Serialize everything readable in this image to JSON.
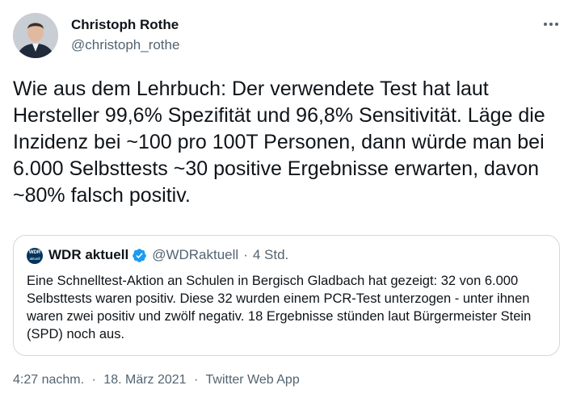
{
  "author": {
    "name": "Christoph Rothe",
    "handle": "@christoph_rothe"
  },
  "tweet": {
    "text": "Wie aus dem Lehrbuch: Der verwendete Test hat laut Hersteller 99,6% Spezifität und 96,8% Sensitivität. Läge die Inzidenz bei ~100 pro 100T Personen, dann würde man bei 6.000 Selbsttests ~30 positive Ergebnisse erwarten, davon ~80% falsch positiv."
  },
  "quoted": {
    "logo_top": "WDR",
    "logo_bottom": "aktuell",
    "name": "WDR aktuell",
    "handle": "@WDRaktuell",
    "separator": "·",
    "time": "4 Std.",
    "text": "Eine Schnelltest-Aktion an Schulen in Bergisch Gladbach hat gezeigt: 32 von 6.000 Selbsttests waren positiv. Diese 32 wurden einem PCR-Test unterzogen - unter ihnen waren zwei positiv und zwölf negativ. 18 Ergebnisse stünden laut Bürgermeister Stein (SPD) noch aus."
  },
  "meta": {
    "time": "4:27 nachm.",
    "separator": "·",
    "date": "18. März 2021",
    "source": "Twitter Web App"
  },
  "colors": {
    "text": "#0f1419",
    "secondary": "#536471",
    "border": "#cfd9de",
    "verified": "#1d9bf0"
  }
}
